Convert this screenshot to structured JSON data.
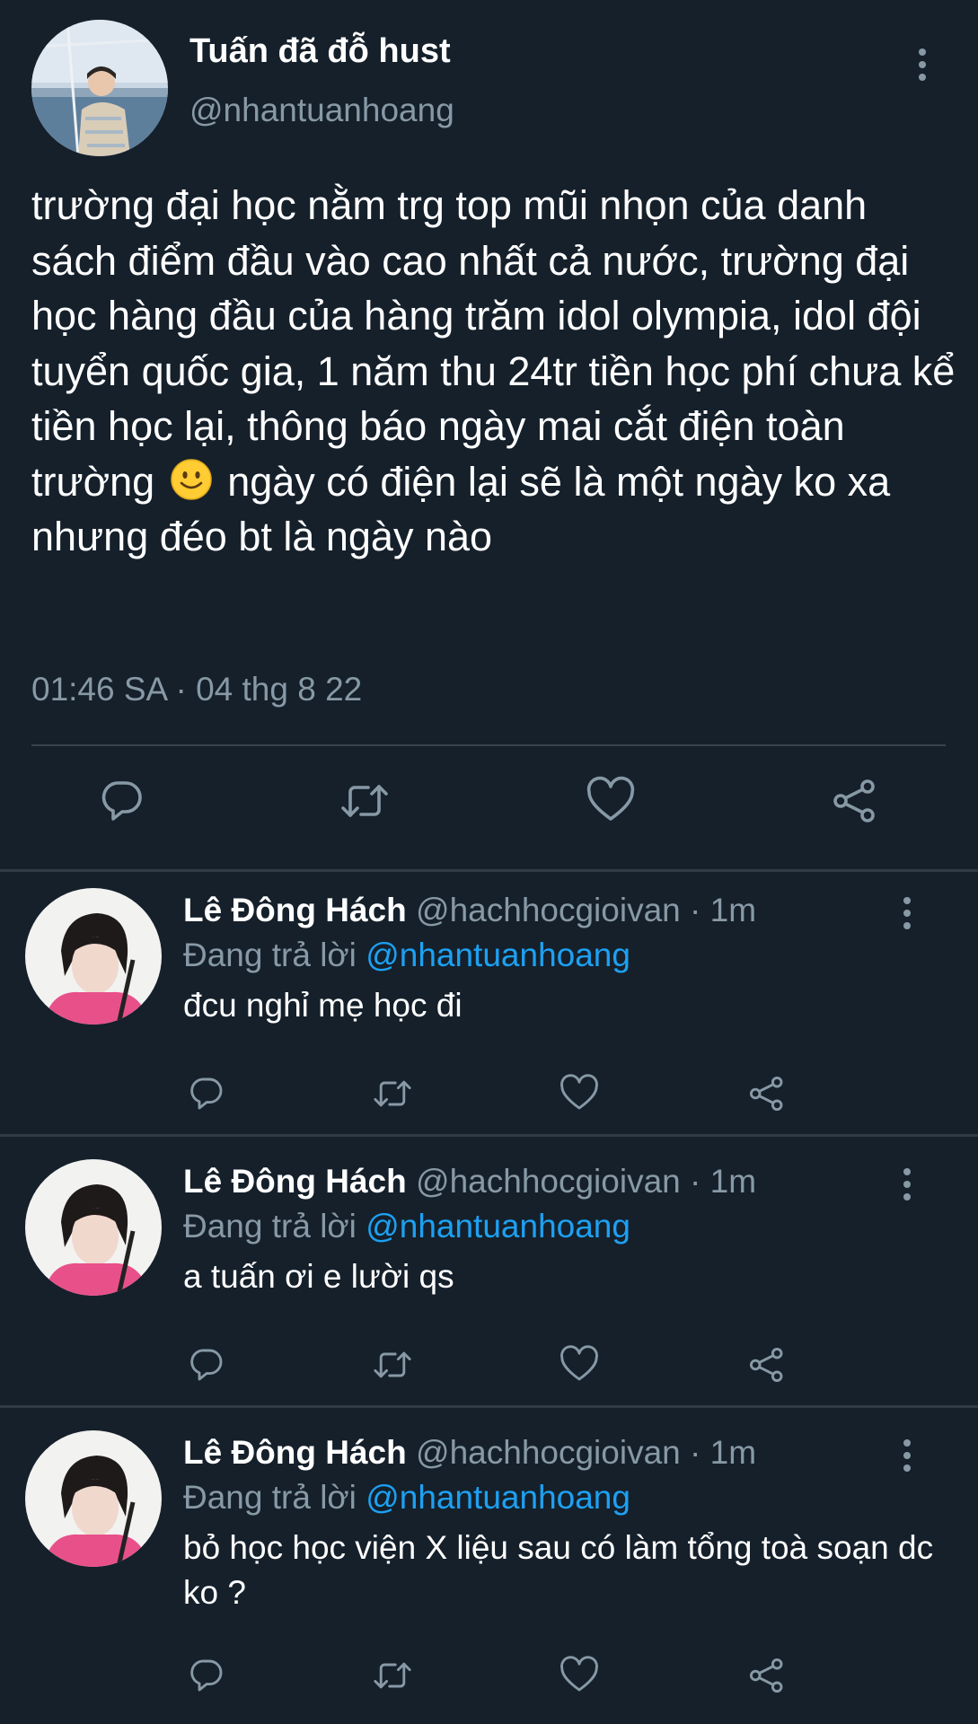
{
  "main_tweet": {
    "display_name": "Tuấn đã đỗ hust",
    "handle": "@nhantuanhoang",
    "text_part1": "trường đại học nằm trg top mũi nhọn của danh sách điểm đầu vào cao nhất cả nước, trường đại học hàng đầu của hàng trăm idol olympia, idol đội tuyển quốc gia, 1 năm thu 24tr tiền học phí chưa kể tiền học lại, thông báo ngày mai cắt điện toàn trường",
    "emoji": "slightly-smiling-face",
    "text_part2": "ngày có điện lại sẽ là một ngày ko xa nhưng đéo bt là ngày nào",
    "timestamp": "01:46 SA · 04 thg 8 22"
  },
  "replies": [
    {
      "display_name": "Lê Đông Hách",
      "meta": "@hachhocgioivan · 1m",
      "replying_label": "Đang trả lời",
      "replying_to": "@nhantuanhoang",
      "text": "đcu nghỉ mẹ học đi"
    },
    {
      "display_name": "Lê Đông Hách",
      "meta": "@hachhocgioivan · 1m",
      "replying_label": "Đang trả lời",
      "replying_to": "@nhantuanhoang",
      "text": "a tuấn ơi e lười qs"
    },
    {
      "display_name": "Lê Đông Hách",
      "meta": "@hachhocgioivan · 1m",
      "replying_label": "Đang trả lời",
      "replying_to": "@nhantuanhoang",
      "text": "bỏ học học viện X liệu sau có làm tổng toà soạn dc ko ?"
    }
  ],
  "icons": [
    "reply-icon",
    "retweet-icon",
    "like-icon",
    "share-icon",
    "more-vertical-icon"
  ],
  "colors": {
    "background": "#15202b",
    "text_primary": "#ffffff",
    "text_secondary": "#8899a6",
    "link": "#1da1f2",
    "divider": "#38444d"
  }
}
